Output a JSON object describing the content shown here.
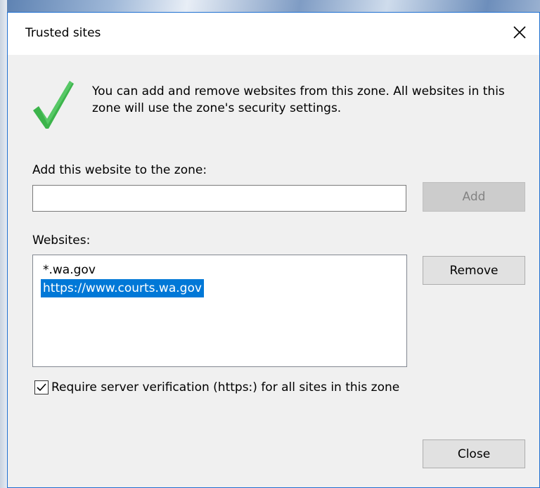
{
  "dialog": {
    "title": "Trusted sites",
    "close_icon": "close-icon"
  },
  "info": {
    "icon": "checkmark-icon",
    "text": "You can add and remove websites from this zone. All websites in this zone will use the zone's security settings."
  },
  "add_section": {
    "label": "Add this website to the zone:",
    "input_value": "",
    "add_button": "Add"
  },
  "websites_section": {
    "label": "Websites:",
    "items": [
      {
        "text": "*.wa.gov",
        "selected": false
      },
      {
        "text": "https://www.courts.wa.gov",
        "selected": true
      }
    ],
    "remove_button": "Remove"
  },
  "verification": {
    "label": "Require server verification (https:) for all sites in this zone",
    "checked": true
  },
  "footer": {
    "close_button": "Close"
  },
  "colors": {
    "selection": "#0078d7",
    "checkmark": "#3cb44b",
    "dialog_border": "#1e6fd0"
  }
}
